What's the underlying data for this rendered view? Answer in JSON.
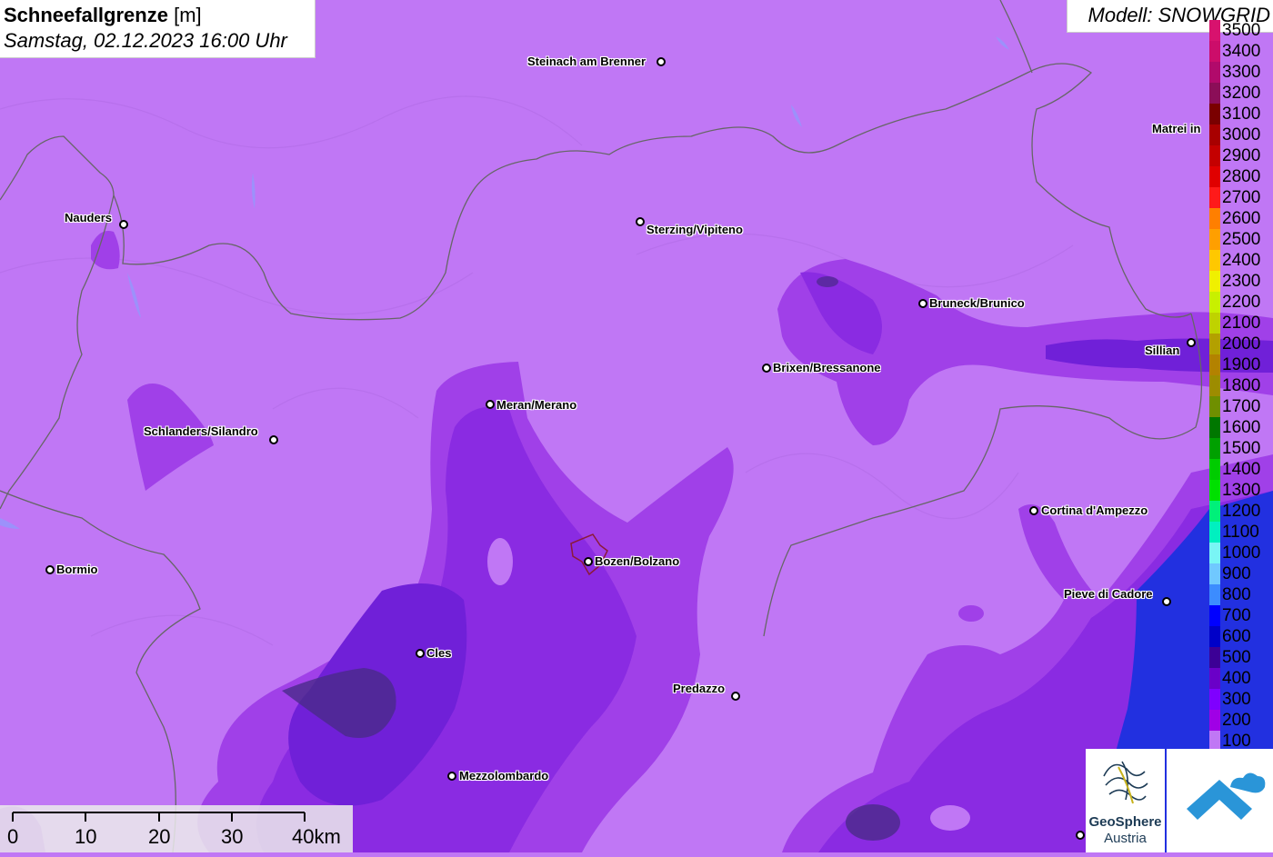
{
  "header": {
    "title_bold": "Schneefallgrenze",
    "title_unit": "[m]",
    "datetime": "Samstag, 02.12.2023 16:00 Uhr"
  },
  "model": {
    "label": "Modell: SNOWGRID"
  },
  "cities": [
    {
      "name": "Steinach am Brenner"
    },
    {
      "name": "Nauders"
    },
    {
      "name": "Sterzing/Vipiteno"
    },
    {
      "name": "Bruneck/Brunico"
    },
    {
      "name": "Sillian"
    },
    {
      "name": "Matrei in"
    },
    {
      "name": "Brixen/Bressanone"
    },
    {
      "name": "Meran/Merano"
    },
    {
      "name": "Schlanders/Silandro"
    },
    {
      "name": "Cortina d'Ampezzo"
    },
    {
      "name": "Bormio"
    },
    {
      "name": "Bozen/Bolzano"
    },
    {
      "name": "Pieve di Cadore"
    },
    {
      "name": "Cles"
    },
    {
      "name": "Predazzo"
    },
    {
      "name": "Mezzolombardo"
    }
  ],
  "legend": {
    "labels": [
      "3500",
      "3400",
      "3300",
      "3200",
      "3100",
      "3000",
      "2900",
      "2800",
      "2700",
      "2600",
      "2500",
      "2400",
      "2300",
      "2200",
      "2100",
      "2000",
      "1900",
      "1800",
      "1700",
      "1600",
      "1500",
      "1400",
      "1300",
      "1200",
      "1100",
      "1000",
      "900",
      "800",
      "700",
      "600",
      "500",
      "400",
      "300",
      "200",
      "100"
    ],
    "colors": [
      "#d8126e",
      "#cc0d6a",
      "#b10a6b",
      "#8b0e58",
      "#7a0000",
      "#a80000",
      "#c40000",
      "#e00000",
      "#ff1a1a",
      "#ff7f00",
      "#ff9f00",
      "#ffc800",
      "#f0f000",
      "#c8f000",
      "#bfd200",
      "#b3a000",
      "#b38200",
      "#9d8c00",
      "#6f8f00",
      "#007700",
      "#00a000",
      "#00cc00",
      "#00e000",
      "#00f07a",
      "#00f0c0",
      "#79f5f5",
      "#70c8ff",
      "#3c8cff",
      "#0000ff",
      "#0000c8",
      "#3c0096",
      "#6a00c8",
      "#7f00ff",
      "#a000e6",
      "#c077f5"
    ]
  },
  "scalebar": {
    "ticks": [
      "0",
      "10",
      "20",
      "30",
      "40km"
    ]
  },
  "logos": {
    "geosphere_line1": "GeoSphere",
    "geosphere_line2": "Austria"
  },
  "colors": {
    "base": "#c077f5",
    "band_300": "#a040e8",
    "band_200": "#8a2be2",
    "band_100": "#6a1fd0",
    "dark": "#4a2a8a",
    "blue": "#2230e0",
    "border": "#666666",
    "bolzano_outline": "#8b1a3a"
  }
}
